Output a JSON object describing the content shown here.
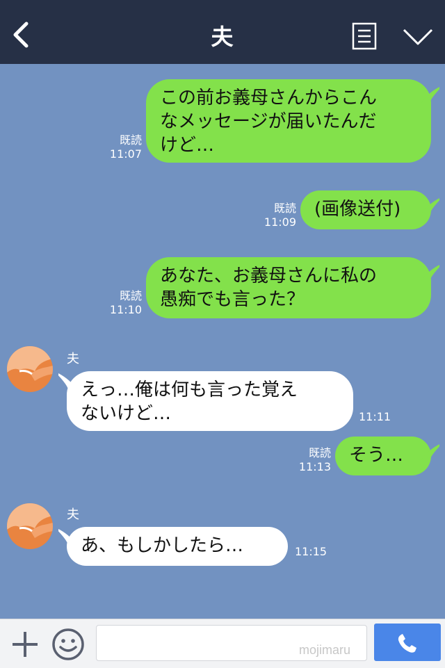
{
  "header": {
    "title": "夫",
    "back_icon": "chevron-left-icon",
    "menu_icon": "document-icon",
    "collapse_icon": "chevron-down-icon",
    "bg_color": "#263046"
  },
  "chat": {
    "bg_color": "#7292c1",
    "mine_color": "#83e14b",
    "theirs_color": "#ffffff",
    "messages": [
      {
        "from": "me",
        "text": "この前お義母さんからこん\nなメッセージが届いたんだ\nけど…",
        "read": "既読",
        "time": "11:07"
      },
      {
        "from": "me",
        "text": "(画像送付)",
        "read": "既読",
        "time": "11:09"
      },
      {
        "from": "me",
        "text": "あなた、お義母さんに私の\n愚痴でも言った？",
        "read": "既読",
        "time": "11:10"
      },
      {
        "from": "them",
        "sender": "夫",
        "text": "えっ…俺は何も言った覚え\nないけど…",
        "time": "11:11"
      },
      {
        "from": "me",
        "text": "そう…",
        "read": "既読",
        "time": "11:13"
      },
      {
        "from": "them",
        "sender": "夫",
        "text": "あ、もしかしたら…",
        "time": "11:15"
      }
    ]
  },
  "inputbar": {
    "plus_icon": "plus-icon",
    "emoji_icon": "smile-icon",
    "placeholder": "",
    "watermark": "mojimaru",
    "call_icon": "phone-icon",
    "call_color": "#4a86e8"
  }
}
